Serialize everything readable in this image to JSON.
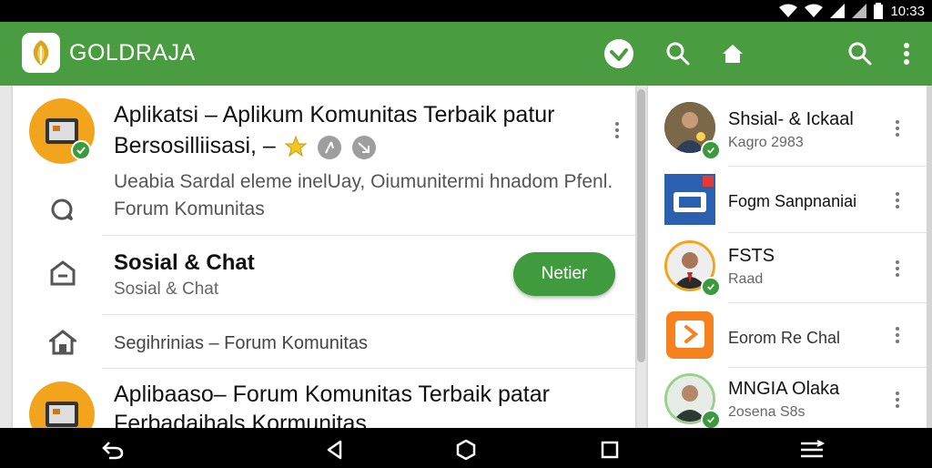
{
  "status_bar": {
    "time": "10:33"
  },
  "app_bar": {
    "title": "GOLDRAJA",
    "icons": [
      "leaf-logo-icon",
      "check-circle-icon",
      "search-icon",
      "home-icon",
      "search-icon",
      "more-vert-icon"
    ]
  },
  "left_list": {
    "item1": {
      "title_line1": "Aplikatsi – Aplikum Komunitas Terbaik patur",
      "title_line2": "Bersosilliisasi, –",
      "desc_line1": "Ueabia Sardal eleme inelUay, Oiumunitermi hnadom Pfenl.",
      "desc_line2": "Forum Komunitas"
    },
    "item2": {
      "title": "Sosial & Chat",
      "subtitle": "Sosial & Chat",
      "button_label": "Netier"
    },
    "item3": {
      "text": "Segihrinias – Forum Komunitas"
    },
    "item4": {
      "title_line1": "Aplibaaso– Forum Komunitas Terbaik patar",
      "title_line2": "Ferbadaihals Kormunitas"
    }
  },
  "right_list": [
    {
      "title": "Shsial- & Ickaal",
      "subtitle": "Kagro 2983"
    },
    {
      "title": "Fogm Sanpnaniai",
      "subtitle": ""
    },
    {
      "title": "FSTS",
      "subtitle": "Raad"
    },
    {
      "title": "Eorom Re Chal",
      "subtitle": ""
    },
    {
      "title": "MNGIA Olaka",
      "subtitle": "2osena S8s"
    }
  ],
  "colors": {
    "primary": "#4a9c41",
    "accent": "#3f9b3d",
    "avatar_gold": "#f2a51c",
    "orange": "#f5821f",
    "blue": "#2b5fb0"
  }
}
